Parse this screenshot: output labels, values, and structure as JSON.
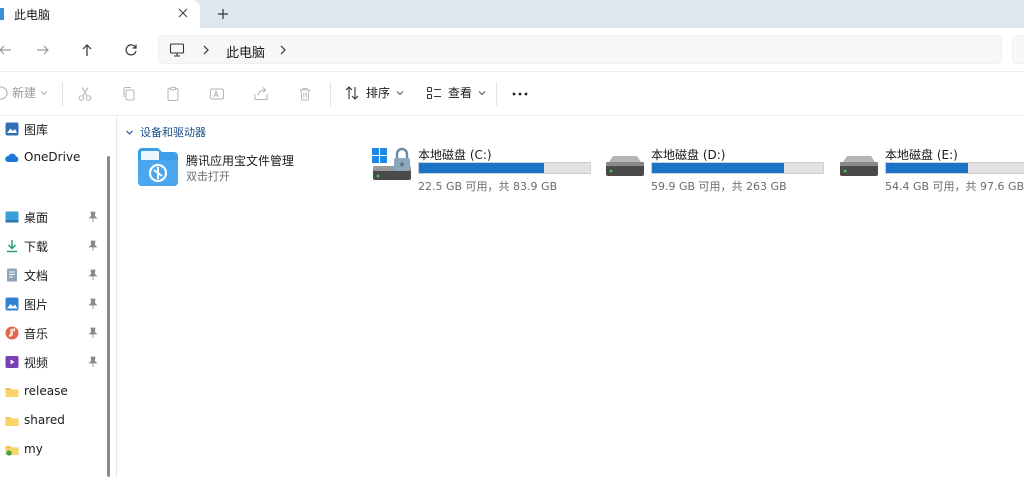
{
  "tab": {
    "title": "此电脑",
    "close_icon": "close-icon",
    "new_tab_icon": "plus-icon"
  },
  "address": {
    "location": "此电脑"
  },
  "toolbar": {
    "new_label": "新建",
    "sort_label": "排序",
    "view_label": "查看"
  },
  "sidebar": {
    "items": [
      {
        "label": "图库",
        "icon": "gallery-icon",
        "pinned": false
      },
      {
        "label": "OneDrive",
        "icon": "onedrive-cloud-icon",
        "pinned": false
      },
      {
        "label": "桌面",
        "icon": "desktop-icon",
        "pinned": true
      },
      {
        "label": "下载",
        "icon": "download-icon",
        "pinned": true
      },
      {
        "label": "文档",
        "icon": "document-icon",
        "pinned": true
      },
      {
        "label": "图片",
        "icon": "pictures-icon",
        "pinned": true
      },
      {
        "label": "音乐",
        "icon": "music-icon",
        "pinned": true
      },
      {
        "label": "视频",
        "icon": "video-icon",
        "pinned": true
      },
      {
        "label": "release",
        "icon": "folder-icon",
        "pinned": false
      },
      {
        "label": "shared",
        "icon": "folder-icon",
        "pinned": false
      },
      {
        "label": "my",
        "icon": "folder-icon",
        "pinned": false
      }
    ]
  },
  "content": {
    "group_header": "设备和驱动器",
    "app": {
      "name": "腾讯应用宝文件管理",
      "subtitle": "双击打开"
    },
    "drives": [
      {
        "name": "本地磁盘 (C:)",
        "size_text": "22.5 GB 可用，共 83.9 GB",
        "used_fraction": 0.732,
        "icon": "system-drive-icon"
      },
      {
        "name": "本地磁盘 (D:)",
        "size_text": "59.9 GB 可用，共 263 GB",
        "used_fraction": 0.772,
        "icon": "hard-drive-icon"
      },
      {
        "name": "本地磁盘 (E:)",
        "size_text": "54.4 GB 可用，共 97.6 GB",
        "used_fraction": 0.443,
        "icon": "hard-drive-icon"
      }
    ]
  },
  "colors": {
    "accent": "#1a73c7",
    "tabstrip": "#dfe7ee",
    "header_text": "#1b4f8a"
  }
}
